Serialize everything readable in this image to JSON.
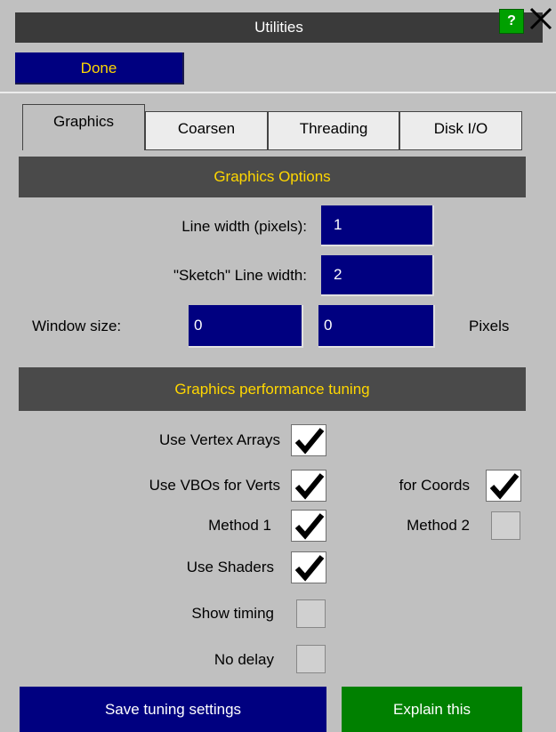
{
  "window": {
    "title": "Utilities",
    "help_label": "?",
    "close_label": "✕"
  },
  "done_label": "Done",
  "tabs": [
    {
      "label": "Graphics",
      "active": true
    },
    {
      "label": "Coarsen",
      "active": false
    },
    {
      "label": "Threading",
      "active": false
    },
    {
      "label": "Disk I/O",
      "active": false
    }
  ],
  "graphics_options": {
    "heading": "Graphics Options",
    "line_width_label": "Line width (pixels):",
    "line_width_value": "1",
    "sketch_width_label": "\"Sketch\" Line width:",
    "sketch_width_value": "2",
    "window_size_label": "Window size:",
    "window_size_x": "0",
    "window_size_y": "0",
    "pixels_label": "Pixels"
  },
  "tuning": {
    "heading": "Graphics performance tuning",
    "use_vertex_arrays": {
      "label": "Use Vertex Arrays",
      "checked": true
    },
    "use_vbos_verts": {
      "label": "Use VBOs for Verts",
      "checked": true
    },
    "for_coords": {
      "label": "for Coords",
      "checked": true
    },
    "method1": {
      "label": "Method 1",
      "checked": true
    },
    "method2": {
      "label": "Method 2",
      "checked": false
    },
    "use_shaders": {
      "label": "Use Shaders",
      "checked": true
    },
    "show_timing": {
      "label": "Show timing",
      "checked": false
    },
    "no_delay": {
      "label": "No delay",
      "checked": false
    }
  },
  "save_tuning_label": "Save tuning settings",
  "explain_label": "Explain this",
  "colors": {
    "panel": "#c0c0c0",
    "title_bar": "#3a3a3a",
    "field_bg": "#000080",
    "accent_text": "#ffd700",
    "green_button": "#008000"
  }
}
